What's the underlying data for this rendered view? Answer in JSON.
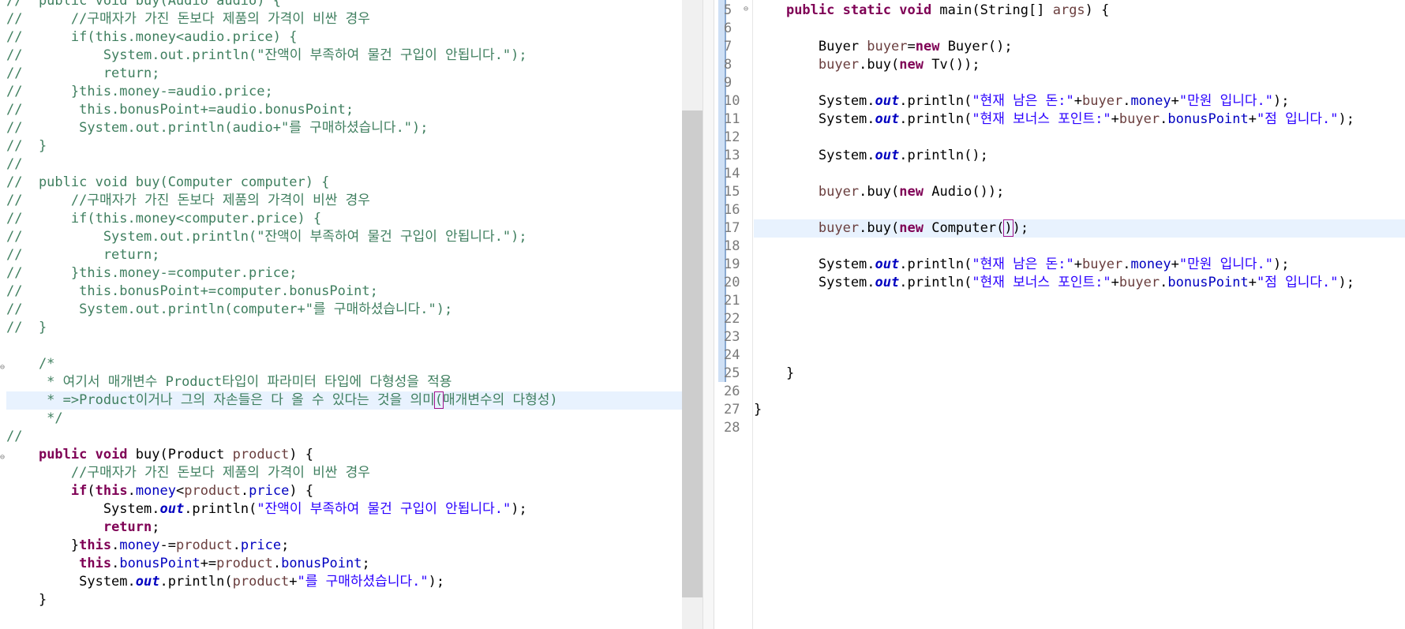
{
  "left_editor": {
    "lines": [
      [
        {
          "t": "//  public void buy(Audio audio) {",
          "c": "cm"
        }
      ],
      [
        {
          "t": "//      //구매자가 가진 돈보다 제품의 가격이 비싼 경우",
          "c": "cm"
        }
      ],
      [
        {
          "t": "//      if(this.money<audio.price) {",
          "c": "cm"
        }
      ],
      [
        {
          "t": "//          System.out.println(\"잔액이 부족하여 물건 구입이 안됩니다.\");",
          "c": "cm"
        }
      ],
      [
        {
          "t": "//          return;",
          "c": "cm"
        }
      ],
      [
        {
          "t": "//      }this.money-=audio.price;",
          "c": "cm"
        }
      ],
      [
        {
          "t": "//       this.bonusPoint+=audio.bonusPoint;",
          "c": "cm"
        }
      ],
      [
        {
          "t": "//       System.out.println(audio+\"를 구매하셨습니다.\");",
          "c": "cm"
        }
      ],
      [
        {
          "t": "//  }",
          "c": "cm"
        }
      ],
      [
        {
          "t": "//",
          "c": "cm"
        }
      ],
      [
        {
          "t": "//  public void buy(Computer computer) {",
          "c": "cm"
        }
      ],
      [
        {
          "t": "//      //구매자가 가진 돈보다 제품의 가격이 비싼 경우",
          "c": "cm"
        }
      ],
      [
        {
          "t": "//      if(this.money<computer.price) {",
          "c": "cm"
        }
      ],
      [
        {
          "t": "//          System.out.println(\"잔액이 부족하여 물건 구입이 안됩니다.\");",
          "c": "cm"
        }
      ],
      [
        {
          "t": "//          return;",
          "c": "cm"
        }
      ],
      [
        {
          "t": "//      }this.money-=computer.price;",
          "c": "cm"
        }
      ],
      [
        {
          "t": "//       this.bonusPoint+=computer.bonusPoint;",
          "c": "cm"
        }
      ],
      [
        {
          "t": "//       System.out.println(computer+\"를 구매하셨습니다.\");",
          "c": "cm"
        }
      ],
      [
        {
          "t": "//  }",
          "c": "cm"
        }
      ],
      [
        {
          "t": "",
          "c": "plain"
        }
      ],
      [
        {
          "t": "    /*",
          "c": "cm"
        }
      ],
      [
        {
          "t": "     * 여기서 매개변수 Product타입이 파라미터 타입에 다형성을 적용",
          "c": "cm"
        }
      ],
      [
        {
          "t": "     * =>Product이거나 그의 자손들은 다 올 수 있다는 것을 의미",
          "c": "cm"
        },
        {
          "t": "(",
          "c": "cm",
          "box": true
        },
        {
          "t": "매개변수의 다형성)",
          "c": "cm"
        }
      ],
      [
        {
          "t": "     */",
          "c": "cm"
        }
      ],
      [
        {
          "t": "//",
          "c": "cm"
        }
      ],
      [
        {
          "t": "    ",
          "c": "plain"
        },
        {
          "t": "public void",
          "c": "kw"
        },
        {
          "t": " buy(Product ",
          "c": "plain"
        },
        {
          "t": "product",
          "c": "var"
        },
        {
          "t": ") {",
          "c": "plain"
        }
      ],
      [
        {
          "t": "        //구매자가 가진 돈보다 제품의 가격이 비싼 경우",
          "c": "cm"
        }
      ],
      [
        {
          "t": "        ",
          "c": "plain"
        },
        {
          "t": "if",
          "c": "kw"
        },
        {
          "t": "(",
          "c": "plain"
        },
        {
          "t": "this",
          "c": "kw"
        },
        {
          "t": ".",
          "c": "plain"
        },
        {
          "t": "money",
          "c": "fld"
        },
        {
          "t": "<",
          "c": "plain"
        },
        {
          "t": "product",
          "c": "var"
        },
        {
          "t": ".",
          "c": "plain"
        },
        {
          "t": "price",
          "c": "fld"
        },
        {
          "t": ") {",
          "c": "plain"
        }
      ],
      [
        {
          "t": "            System.",
          "c": "plain"
        },
        {
          "t": "out",
          "c": "sfld"
        },
        {
          "t": ".println(",
          "c": "plain"
        },
        {
          "t": "\"잔액이 부족하여 물건 구입이 안됩니다.\"",
          "c": "str"
        },
        {
          "t": ");",
          "c": "plain"
        }
      ],
      [
        {
          "t": "            ",
          "c": "plain"
        },
        {
          "t": "return",
          "c": "kw"
        },
        {
          "t": ";",
          "c": "plain"
        }
      ],
      [
        {
          "t": "        }",
          "c": "plain"
        },
        {
          "t": "this",
          "c": "kw"
        },
        {
          "t": ".",
          "c": "plain"
        },
        {
          "t": "money",
          "c": "fld"
        },
        {
          "t": "-=",
          "c": "plain"
        },
        {
          "t": "product",
          "c": "var"
        },
        {
          "t": ".",
          "c": "plain"
        },
        {
          "t": "price",
          "c": "fld"
        },
        {
          "t": ";",
          "c": "plain"
        }
      ],
      [
        {
          "t": "         ",
          "c": "plain"
        },
        {
          "t": "this",
          "c": "kw"
        },
        {
          "t": ".",
          "c": "plain"
        },
        {
          "t": "bonusPoint",
          "c": "fld"
        },
        {
          "t": "+=",
          "c": "plain"
        },
        {
          "t": "product",
          "c": "var"
        },
        {
          "t": ".",
          "c": "plain"
        },
        {
          "t": "bonusPoint",
          "c": "fld"
        },
        {
          "t": ";",
          "c": "plain"
        }
      ],
      [
        {
          "t": "         System.",
          "c": "plain"
        },
        {
          "t": "out",
          "c": "sfld"
        },
        {
          "t": ".println(",
          "c": "plain"
        },
        {
          "t": "product",
          "c": "var"
        },
        {
          "t": "+",
          "c": "plain"
        },
        {
          "t": "\"를 구매하셨습니다.\"",
          "c": "str"
        },
        {
          "t": ");",
          "c": "plain"
        }
      ],
      [
        {
          "t": "    }",
          "c": "plain"
        }
      ]
    ]
  },
  "right_editor": {
    "lines": [
      {
        "n": "5",
        "segs": [
          {
            "t": "    ",
            "c": "plain"
          },
          {
            "t": "public static void",
            "c": "kw"
          },
          {
            "t": " main(String[] ",
            "c": "plain"
          },
          {
            "t": "args",
            "c": "var"
          },
          {
            "t": ") {",
            "c": "plain"
          }
        ]
      },
      {
        "n": "6",
        "segs": []
      },
      {
        "n": "7",
        "segs": [
          {
            "t": "        Buyer ",
            "c": "plain"
          },
          {
            "t": "buyer",
            "c": "var"
          },
          {
            "t": "=",
            "c": "plain"
          },
          {
            "t": "new",
            "c": "kw"
          },
          {
            "t": " Buyer();",
            "c": "plain"
          }
        ]
      },
      {
        "n": "8",
        "segs": [
          {
            "t": "        ",
            "c": "plain"
          },
          {
            "t": "buyer",
            "c": "var"
          },
          {
            "t": ".buy(",
            "c": "plain"
          },
          {
            "t": "new",
            "c": "kw"
          },
          {
            "t": " Tv());",
            "c": "plain"
          }
        ]
      },
      {
        "n": "9",
        "segs": []
      },
      {
        "n": "10",
        "segs": [
          {
            "t": "        System.",
            "c": "plain"
          },
          {
            "t": "out",
            "c": "sfld"
          },
          {
            "t": ".println(",
            "c": "plain"
          },
          {
            "t": "\"현재 남은 돈:\"",
            "c": "str"
          },
          {
            "t": "+",
            "c": "plain"
          },
          {
            "t": "buyer",
            "c": "var"
          },
          {
            "t": ".",
            "c": "plain"
          },
          {
            "t": "money",
            "c": "fld"
          },
          {
            "t": "+",
            "c": "plain"
          },
          {
            "t": "\"만원 입니다.\"",
            "c": "str"
          },
          {
            "t": ");",
            "c": "plain"
          }
        ]
      },
      {
        "n": "11",
        "segs": [
          {
            "t": "        System.",
            "c": "plain"
          },
          {
            "t": "out",
            "c": "sfld"
          },
          {
            "t": ".println(",
            "c": "plain"
          },
          {
            "t": "\"현재 보너스 포인트:\"",
            "c": "str"
          },
          {
            "t": "+",
            "c": "plain"
          },
          {
            "t": "buyer",
            "c": "var"
          },
          {
            "t": ".",
            "c": "plain"
          },
          {
            "t": "bonusPoint",
            "c": "fld"
          },
          {
            "t": "+",
            "c": "plain"
          },
          {
            "t": "\"점 입니다.\"",
            "c": "str"
          },
          {
            "t": ");",
            "c": "plain"
          }
        ]
      },
      {
        "n": "12",
        "segs": []
      },
      {
        "n": "13",
        "segs": [
          {
            "t": "        System.",
            "c": "plain"
          },
          {
            "t": "out",
            "c": "sfld"
          },
          {
            "t": ".println();",
            "c": "plain"
          }
        ]
      },
      {
        "n": "14",
        "segs": []
      },
      {
        "n": "15",
        "segs": [
          {
            "t": "        ",
            "c": "plain"
          },
          {
            "t": "buyer",
            "c": "var"
          },
          {
            "t": ".buy(",
            "c": "plain"
          },
          {
            "t": "new",
            "c": "kw"
          },
          {
            "t": " Audio());",
            "c": "plain"
          }
        ]
      },
      {
        "n": "16",
        "segs": []
      },
      {
        "n": "17",
        "segs": [
          {
            "t": "        ",
            "c": "plain"
          },
          {
            "t": "buyer",
            "c": "var"
          },
          {
            "t": ".buy(",
            "c": "plain"
          },
          {
            "t": "new",
            "c": "kw"
          },
          {
            "t": " Computer(",
            "c": "plain"
          },
          {
            "t": ")",
            "c": "plain",
            "box": true
          },
          {
            "t": ");",
            "c": "plain"
          }
        ]
      },
      {
        "n": "18",
        "segs": []
      },
      {
        "n": "19",
        "segs": [
          {
            "t": "        System.",
            "c": "plain"
          },
          {
            "t": "out",
            "c": "sfld"
          },
          {
            "t": ".println(",
            "c": "plain"
          },
          {
            "t": "\"현재 남은 돈:\"",
            "c": "str"
          },
          {
            "t": "+",
            "c": "plain"
          },
          {
            "t": "buyer",
            "c": "var"
          },
          {
            "t": ".",
            "c": "plain"
          },
          {
            "t": "money",
            "c": "fld"
          },
          {
            "t": "+",
            "c": "plain"
          },
          {
            "t": "\"만원 입니다.\"",
            "c": "str"
          },
          {
            "t": ");",
            "c": "plain"
          }
        ]
      },
      {
        "n": "20",
        "segs": [
          {
            "t": "        System.",
            "c": "plain"
          },
          {
            "t": "out",
            "c": "sfld"
          },
          {
            "t": ".println(",
            "c": "plain"
          },
          {
            "t": "\"현재 보너스 포인트:\"",
            "c": "str"
          },
          {
            "t": "+",
            "c": "plain"
          },
          {
            "t": "buyer",
            "c": "var"
          },
          {
            "t": ".",
            "c": "plain"
          },
          {
            "t": "bonusPoint",
            "c": "fld"
          },
          {
            "t": "+",
            "c": "plain"
          },
          {
            "t": "\"점 입니다.\"",
            "c": "str"
          },
          {
            "t": ");",
            "c": "plain"
          }
        ]
      },
      {
        "n": "21",
        "segs": []
      },
      {
        "n": "22",
        "segs": []
      },
      {
        "n": "23",
        "segs": []
      },
      {
        "n": "24",
        "segs": []
      },
      {
        "n": "25",
        "segs": [
          {
            "t": "    }",
            "c": "plain"
          }
        ]
      },
      {
        "n": "26",
        "segs": []
      },
      {
        "n": "27",
        "segs": [
          {
            "t": "}",
            "c": "plain"
          }
        ]
      },
      {
        "n": "28",
        "segs": []
      }
    ]
  },
  "colors": {
    "keyword": "#7f0055",
    "string": "#2a00ff",
    "comment": "#3f7f5f",
    "field": "#0000c0",
    "local_variable": "#6a3e3e",
    "current_line": "#e8f2fe"
  }
}
